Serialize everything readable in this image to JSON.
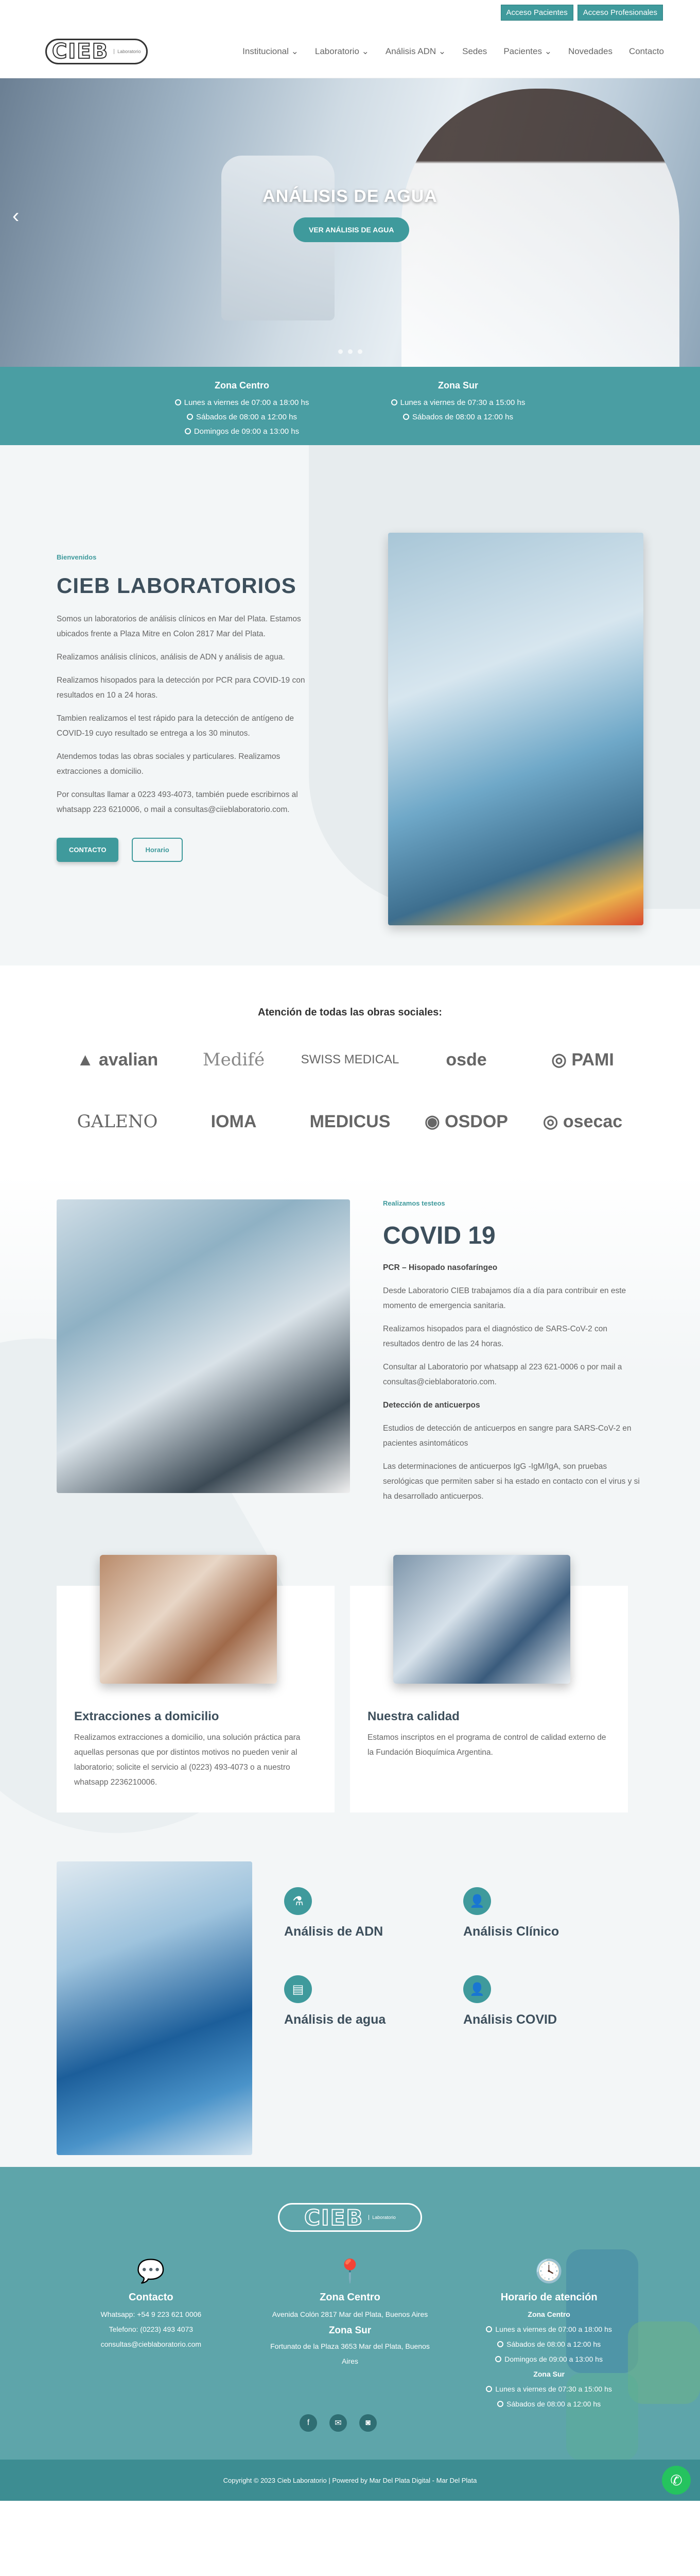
{
  "topbar": {
    "pacientes": "Acceso Pacientes",
    "profesionales": "Acceso Profesionales"
  },
  "logo": {
    "mark": "CIEB",
    "sub": "Laboratorio"
  },
  "menu": [
    {
      "label": "Institucional ⌄"
    },
    {
      "label": "Laboratorio ⌄"
    },
    {
      "label": "Análisis ADN ⌄"
    },
    {
      "label": "Sedes"
    },
    {
      "label": "Pacientes ⌄"
    },
    {
      "label": "Novedades"
    },
    {
      "label": "Contacto"
    }
  ],
  "hero": {
    "title": "ANÁLISIS DE AGUA",
    "cta": "VER ANÁLISIS DE AGUA",
    "arrow": "‹"
  },
  "hours": {
    "centro": {
      "title": "Zona Centro",
      "lines": [
        "Lunes a viernes de 07:00 a 18:00 hs",
        "Sábados de 08:00 a 12:00 hs",
        "Domingos de 09:00 a 13:00 hs"
      ]
    },
    "sur": {
      "title": "Zona Sur",
      "lines": [
        "Lunes a viernes de 07:30 a 15:00 hs",
        "Sábados de 08:00 a 12:00 hs"
      ]
    }
  },
  "about": {
    "kicker": "Bienvenidos",
    "title": "CIEB LABORATORIOS",
    "paragraphs": [
      "Somos un laboratorios de análisis clínicos en Mar del Plata. Estamos ubicados frente a Plaza Mitre en Colon 2817 Mar del Plata.",
      "Realizamos análisis clínicos, análisis de ADN y análisis de agua.",
      "Realizamos hisopados para la detección por PCR para COVID-19 con resultados en 10 a 24 horas.",
      "Tambien realizamos el test rápido para la detección de antígeno de COVID-19 cuyo resultado se entrega a los 30 minutos.",
      "Atendemos todas las obras sociales y particulares. Realizamos extracciones a domicilio.",
      "Por consultas llamar a 0223 493-4073, también puede escribirnos al whatsapp 223 6210006, o mail a consultas@ciieblaboratorio.com."
    ],
    "btn_contacto": "CONTACTO",
    "btn_horario": "Horario"
  },
  "obras": {
    "title": "Atención de todas las obras sociales:",
    "logos": [
      "▲ avalian",
      "Medifé",
      "SWISS MEDICAL",
      "osde",
      "◎ PAMI",
      "GALENO",
      "IOMA",
      "MEDICUS",
      "◉ OSDOP",
      "◎ osecac"
    ]
  },
  "covid": {
    "kicker": "Realizamos testeos",
    "title": "COVID 19",
    "h1": "PCR – Hisopado nasofaríngeo",
    "p1": "Desde Laboratorio CIEB trabajamos día a día para contribuir en este momento de emergencia sanitaria.",
    "p2": "Realizamos hisopados para el diagnóstico de SARS-CoV-2 con resultados dentro de las 24 horas.",
    "p3": "Consultar al Laboratorio por whatsapp al 223 621-0006 o por mail a consultas@cieblaboratorio.com.",
    "h2": "Detección de anticuerpos",
    "p4": "Estudios de detección de anticuerpos en sangre para SARS-CoV-2 en pacientes asintomáticos",
    "p5": "Las determinaciones de anticuerpos IgG -IgM/IgA, son pruebas serológicas que permiten saber si ha estado en contacto con el virus y si ha desarrollado anticuerpos."
  },
  "cards": [
    {
      "title": "Extracciones a domicilio",
      "text": "Realizamos extracciones a domicilio, una solución práctica para aquellas personas que por distintos motivos no pueden venir al laboratorio; solicite el servicio al (0223) 493-4073 o a nuestro whatsapp 2236210006."
    },
    {
      "title": "Nuestra calidad",
      "text": "Estamos inscriptos en el programa de control de calidad externo de la Fundación Bioquímica Argentina."
    }
  ],
  "analisis": [
    {
      "title": "Análisis de ADN",
      "icon": "⚗"
    },
    {
      "title": "Análisis Clínico",
      "icon": "👤"
    },
    {
      "title": "Análisis de agua",
      "icon": "▤"
    },
    {
      "title": "Análisis COVID",
      "icon": "👤"
    }
  ],
  "footer": {
    "contacto": {
      "title": "Contacto",
      "icon": "💬",
      "lines": [
        "Whatsapp: +54 9 223 621 0006",
        "Telefono: (0223) 493 4073",
        "consultas@cieblaboratorio.com"
      ]
    },
    "zonas": {
      "icon": "📍",
      "centro": "Zona Centro",
      "centro_dir": "Avenida Colón 2817 Mar del Plata, Buenos Aires",
      "sur": "Zona Sur",
      "sur_dir": "Fortunato de la Plaza 3653 Mar del Plata, Buenos Aires"
    },
    "horario": {
      "title": "Horario de atención",
      "icon": "🕓",
      "centro": "Zona Centro",
      "centro_lines": [
        "Lunes a viernes de 07:00 a 18:00 hs",
        "Sábados de 08:00 a 12:00 hs",
        "Domingos de 09:00 a 13:00 hs"
      ],
      "sur": "Zona Sur",
      "sur_lines": [
        "Lunes a viernes de 07:30 a 15:00 hs",
        "Sábados de 08:00 a 12:00 hs"
      ]
    },
    "social": [
      "f",
      "✉",
      "◙"
    ],
    "copyright": "Copyright © 2023 Cieb Laboratorio | Powered by Mar Del Plata Digital - Mar Del Plata",
    "whatsapp": "✆"
  }
}
